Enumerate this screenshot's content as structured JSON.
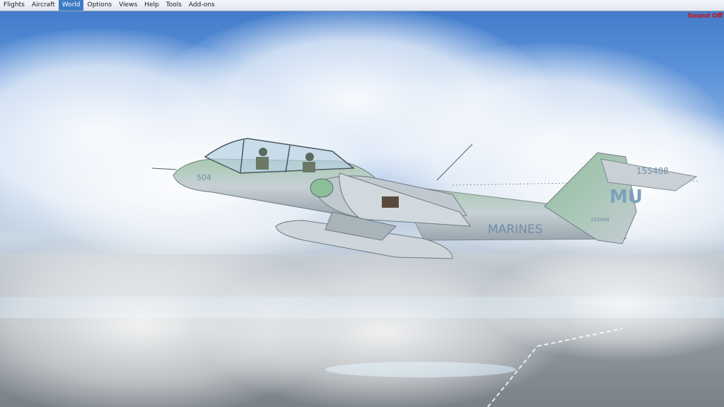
{
  "menu": {
    "items": [
      {
        "label": "Flights",
        "active": false
      },
      {
        "label": "Aircraft",
        "active": false
      },
      {
        "label": "World",
        "active": true
      },
      {
        "label": "Options",
        "active": false
      },
      {
        "label": "Views",
        "active": false
      },
      {
        "label": "Help",
        "active": false
      },
      {
        "label": "Tools",
        "active": false
      },
      {
        "label": "Add-ons",
        "active": false
      }
    ]
  },
  "status": {
    "sound": "Sound Off",
    "sound_color": "#d10f0f"
  },
  "aircraft": {
    "nose_number": "504",
    "tail_code": "MU",
    "tail_serial": "155488",
    "fuselage_text": "MARINES",
    "boom_serial": "155488",
    "icon": "ov10-bronco-aircraft"
  },
  "colors": {
    "menu_active": "#3d7bc6",
    "sky_top": "#3f78c9",
    "aircraft_green": "#8fbf9c",
    "aircraft_gray": "#c3ccd3"
  }
}
